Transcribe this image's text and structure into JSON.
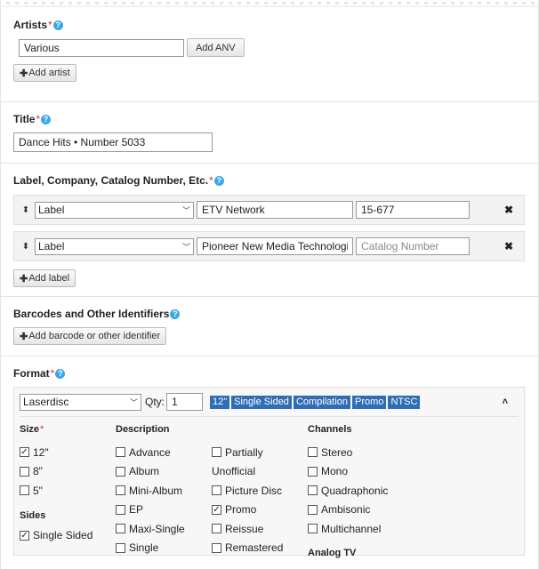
{
  "artists": {
    "title": "Artists",
    "required_mark": "*",
    "help": "?",
    "artist_value": "Various",
    "add_anv": "Add ANV",
    "add_artist": "Add artist"
  },
  "title_section": {
    "title": "Title",
    "required_mark": "*",
    "help": "?",
    "value": "Dance Hits • Number 5033"
  },
  "labels": {
    "title": "Label, Company, Catalog Number, Etc.",
    "required_mark": "*",
    "help": "?",
    "rows": [
      {
        "type": "Label",
        "name": "ETV Network",
        "catno": "15-677",
        "catno_placeholder": "Catalog Number"
      },
      {
        "type": "Label",
        "name": "Pioneer New Media Technologies",
        "catno": "",
        "catno_placeholder": "Catalog Number"
      }
    ],
    "remove": "✖",
    "add_label": "Add label"
  },
  "barcodes": {
    "title": "Barcodes and Other Identifiers",
    "help": "?",
    "add": "Add barcode or other identifier"
  },
  "format": {
    "title": "Format",
    "required_mark": "*",
    "help": "?",
    "media": "Laserdisc",
    "qty_label": "Qty:",
    "qty": "1",
    "tags": [
      "12\"",
      "Single Sided",
      "Compilation",
      "Promo",
      "NTSC"
    ],
    "collapse": "⌃",
    "size": {
      "title": "Size",
      "required_mark": "*",
      "options": [
        {
          "label": "12\"",
          "checked": true
        },
        {
          "label": "8\"",
          "checked": false
        },
        {
          "label": "5\"",
          "checked": false
        }
      ]
    },
    "sides": {
      "title": "Sides",
      "options": [
        {
          "label": "Single Sided",
          "checked": true
        }
      ]
    },
    "description": {
      "title": "Description",
      "col1": [
        {
          "label": "Advance",
          "checked": false
        },
        {
          "label": "Album",
          "checked": false
        },
        {
          "label": "Mini-Album",
          "checked": false
        },
        {
          "label": "EP",
          "checked": false
        },
        {
          "label": "Maxi-Single",
          "checked": false
        },
        {
          "label": "Single",
          "checked": false
        }
      ],
      "col2_partially": "Partially",
      "col2_unofficial": "Unofficial",
      "col2": [
        {
          "label": "Picture Disc",
          "checked": false
        },
        {
          "label": "Promo",
          "checked": true
        },
        {
          "label": "Reissue",
          "checked": false
        },
        {
          "label": "Remastered",
          "checked": false
        }
      ]
    },
    "channels": {
      "title": "Channels",
      "options": [
        {
          "label": "Stereo",
          "checked": false
        },
        {
          "label": "Mono",
          "checked": false
        },
        {
          "label": "Quadraphonic",
          "checked": false
        },
        {
          "label": "Ambisonic",
          "checked": false
        },
        {
          "label": "Multichannel",
          "checked": false
        }
      ]
    },
    "analog_tv": {
      "title": "Analog TV"
    }
  }
}
